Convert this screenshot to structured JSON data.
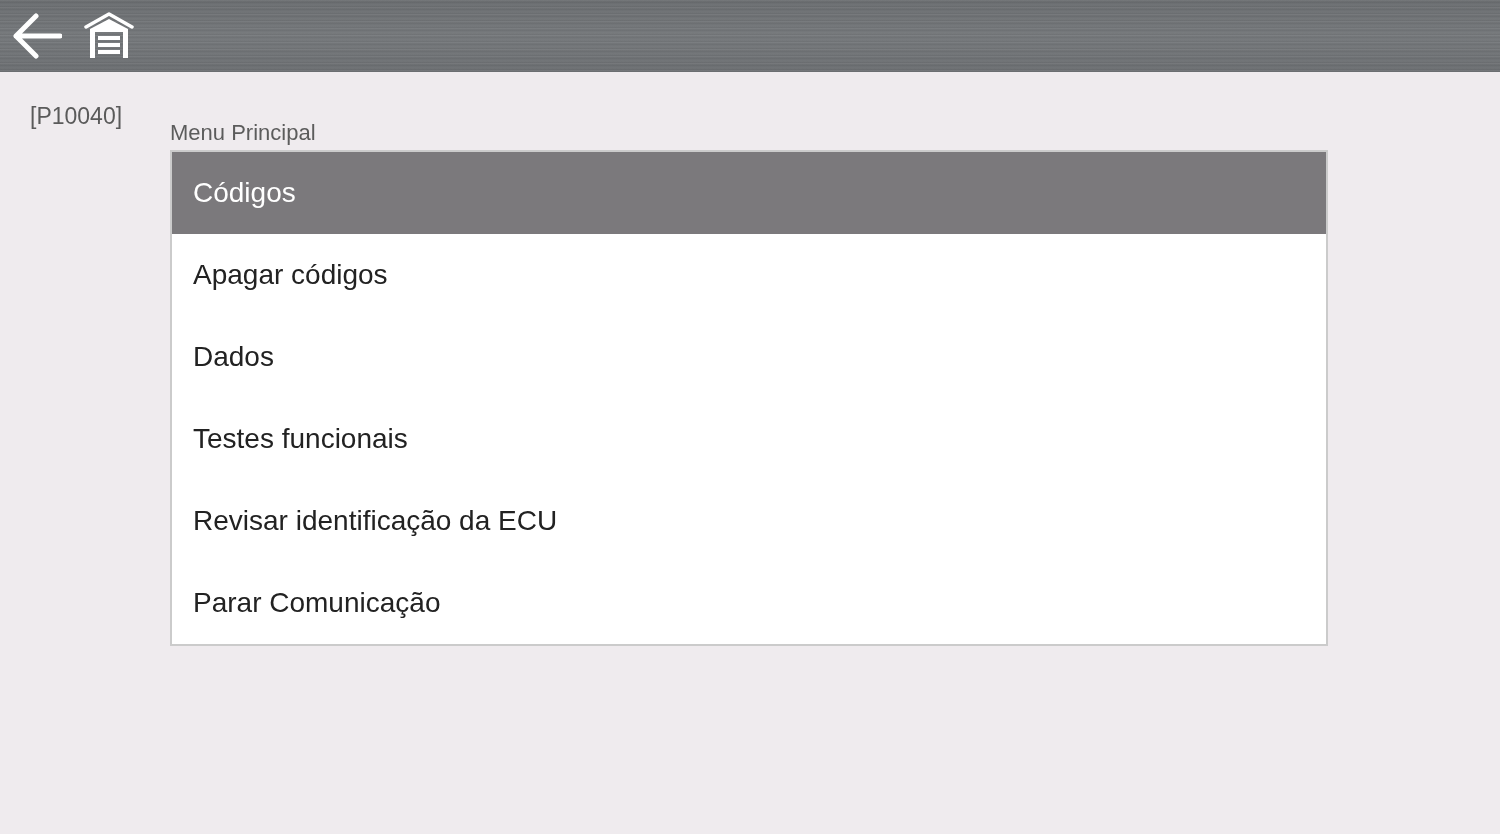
{
  "screen_code": "[P10040]",
  "menu": {
    "title": "Menu Principal",
    "items": [
      {
        "label": "Códigos",
        "selected": true
      },
      {
        "label": "Apagar códigos",
        "selected": false
      },
      {
        "label": "Dados",
        "selected": false
      },
      {
        "label": "Testes funcionais",
        "selected": false
      },
      {
        "label": "Revisar identificação da ECU",
        "selected": false
      },
      {
        "label": "Parar Comunicação",
        "selected": false
      }
    ]
  }
}
